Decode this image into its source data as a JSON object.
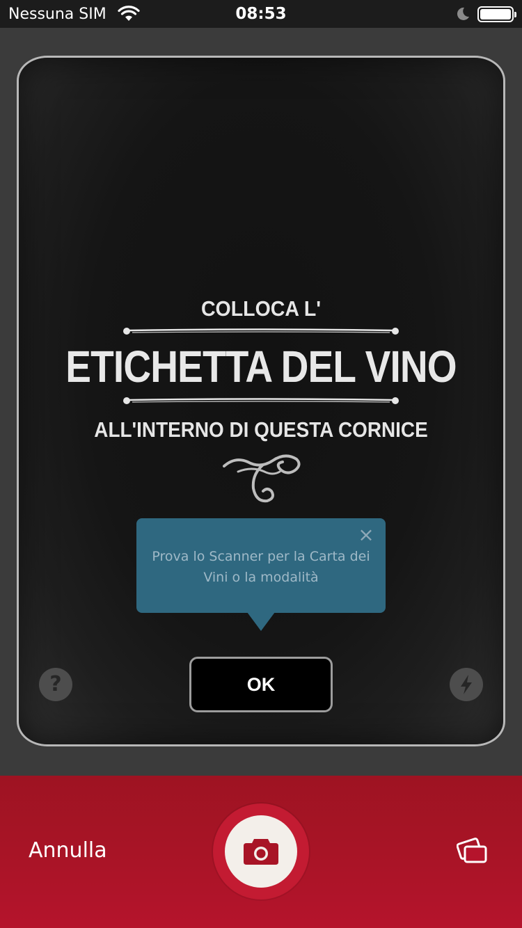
{
  "status_bar": {
    "carrier": "Nessuna SIM",
    "time": "08:53",
    "battery_level": 1.0
  },
  "scanner": {
    "heading_top": "COLLOCA L'",
    "heading_main": "ETICHETTA DEL VINO",
    "heading_bottom": "ALL'INTERNO DI QUESTA CORNICE"
  },
  "tooltip": {
    "text": "Prova lo Scanner per la Carta dei Vini o la modalità",
    "close_icon": "close-icon"
  },
  "ok_button": {
    "label": "OK"
  },
  "side_buttons": {
    "help_label": "?",
    "help_icon": "question-icon",
    "flash_icon": "flash-icon"
  },
  "bottom_bar": {
    "cancel_label": "Annulla",
    "shutter_icon": "camera-icon",
    "mode_icon": "wine-list-cards-icon",
    "color": "#a81426"
  }
}
